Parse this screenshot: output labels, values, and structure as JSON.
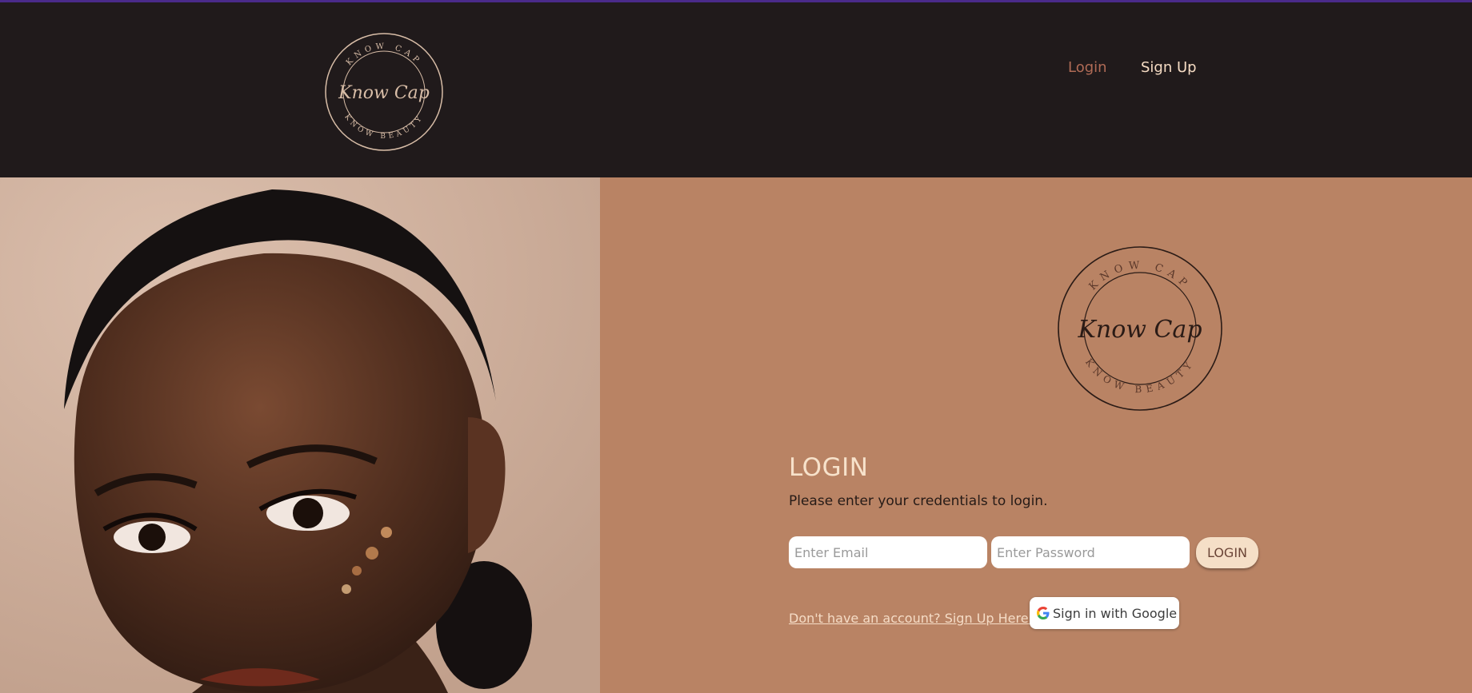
{
  "header": {
    "logo_text": {
      "top_arc": "KNOW CAP",
      "script": "Know Cap",
      "bottom_arc": "KNOW BEAUTY"
    },
    "nav": {
      "login": "Login",
      "signup": "Sign Up"
    }
  },
  "colors": {
    "header_bg": "#201a1b",
    "panel_bg": "#b98364",
    "accent_cream": "#f5dfc7",
    "nav_login": "#b06b56"
  },
  "login": {
    "title": "LOGIN",
    "subtitle": "Please enter your credentials to login.",
    "email_placeholder": "Enter Email",
    "password_placeholder": "Enter Password",
    "button": "LOGIN",
    "signup_link": "Don't have an account? Sign Up Here!",
    "google_button": "Sign in with Google"
  },
  "icons": {
    "google": "google-g-icon",
    "logo": "know-cap-logo"
  }
}
